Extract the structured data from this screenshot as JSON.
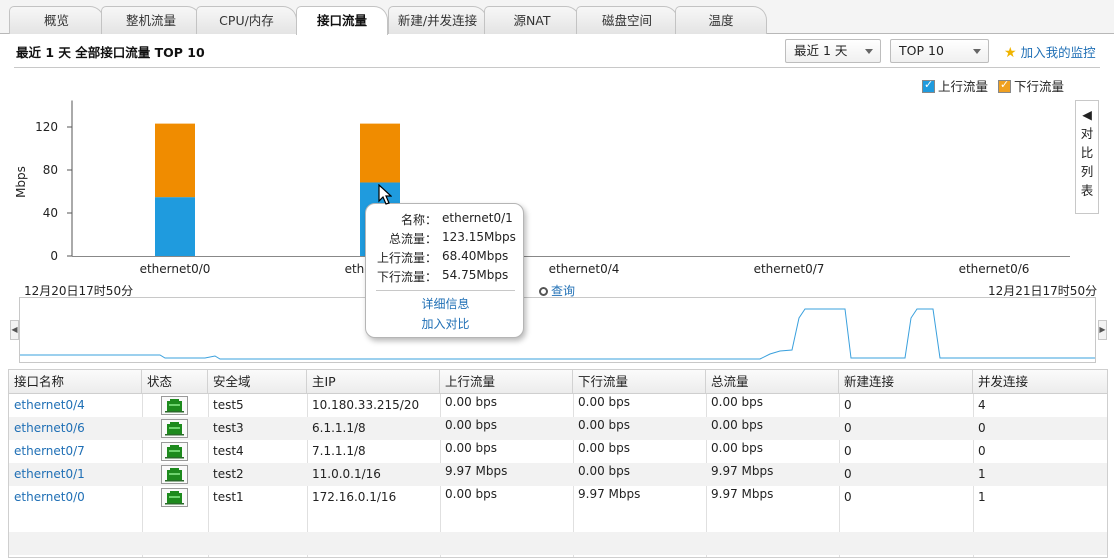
{
  "tabs": [
    {
      "label": "概览",
      "active": false
    },
    {
      "label": "整机流量",
      "active": false
    },
    {
      "label": "CPU/内存",
      "active": false
    },
    {
      "label": "接口流量",
      "active": true
    },
    {
      "label": "新建/并发连接",
      "active": false
    },
    {
      "label": "源NAT",
      "active": false
    },
    {
      "label": "磁盘空间",
      "active": false
    },
    {
      "label": "温度",
      "active": false
    }
  ],
  "header": {
    "title": "最近 1 天  全部接口流量  TOP 10",
    "period_select": "最近 1 天",
    "top_select": "TOP 10",
    "add_monitor": "加入我的监控"
  },
  "legend": {
    "up": {
      "label": "上行流量",
      "color": "#1f9bde"
    },
    "down": {
      "label": "下行流量",
      "color": "#f08c00"
    }
  },
  "side_panel": {
    "arrow": "◀",
    "label": [
      "对",
      "比",
      "列",
      "表"
    ]
  },
  "chart_data": {
    "type": "bar",
    "stacked": true,
    "categories": [
      "ethernet0/0",
      "ethernet0/1",
      "ethernet0/4",
      "ethernet0/7",
      "ethernet0/6"
    ],
    "series": [
      {
        "name": "上行流量",
        "values": [
          54.75,
          68.4,
          0,
          0,
          0
        ],
        "color": "#1f9bde"
      },
      {
        "name": "下行流量",
        "values": [
          68.4,
          54.75,
          0,
          0,
          0
        ],
        "color": "#f08c00"
      }
    ],
    "ylabel": "Mbps",
    "ylim": [
      0,
      140
    ],
    "yticks": [
      0,
      40,
      80,
      120
    ]
  },
  "time_range": {
    "start": "12月20日17时50分",
    "end": "12月21日17时50分",
    "query_label": "查询"
  },
  "tooltip": {
    "rows": [
      {
        "k": "名称：",
        "v": "ethernet0/1"
      },
      {
        "k": "总流量：",
        "v": "123.15Mbps"
      },
      {
        "k": "上行流量：",
        "v": "68.40Mbps"
      },
      {
        "k": "下行流量：",
        "v": "54.75Mbps"
      }
    ],
    "details_link": "详细信息",
    "compare_link": "加入对比"
  },
  "table": {
    "headers": [
      "接口名称",
      "状态",
      "安全域",
      "主IP",
      "上行流量",
      "下行流量",
      "总流量",
      "新建连接",
      "并发连接"
    ],
    "rows": [
      [
        "ethernet0/4",
        "",
        "test5",
        "10.180.33.215/20",
        "0.00 bps",
        "0.00 bps",
        "0.00 bps",
        "0",
        "4"
      ],
      [
        "ethernet0/6",
        "",
        "test3",
        "6.1.1.1/8",
        "0.00 bps",
        "0.00 bps",
        "0.00 bps",
        "0",
        "0"
      ],
      [
        "ethernet0/7",
        "",
        "test4",
        "7.1.1.1/8",
        "0.00 bps",
        "0.00 bps",
        "0.00 bps",
        "0",
        "0"
      ],
      [
        "ethernet0/1",
        "",
        "test2",
        "11.0.0.1/16",
        "9.97 Mbps",
        "0.00 bps",
        "9.97 Mbps",
        "0",
        "1"
      ],
      [
        "ethernet0/0",
        "",
        "test1",
        "172.16.0.1/16",
        "0.00 bps",
        "9.97 Mbps",
        "9.97 Mbps",
        "0",
        "1"
      ]
    ]
  }
}
